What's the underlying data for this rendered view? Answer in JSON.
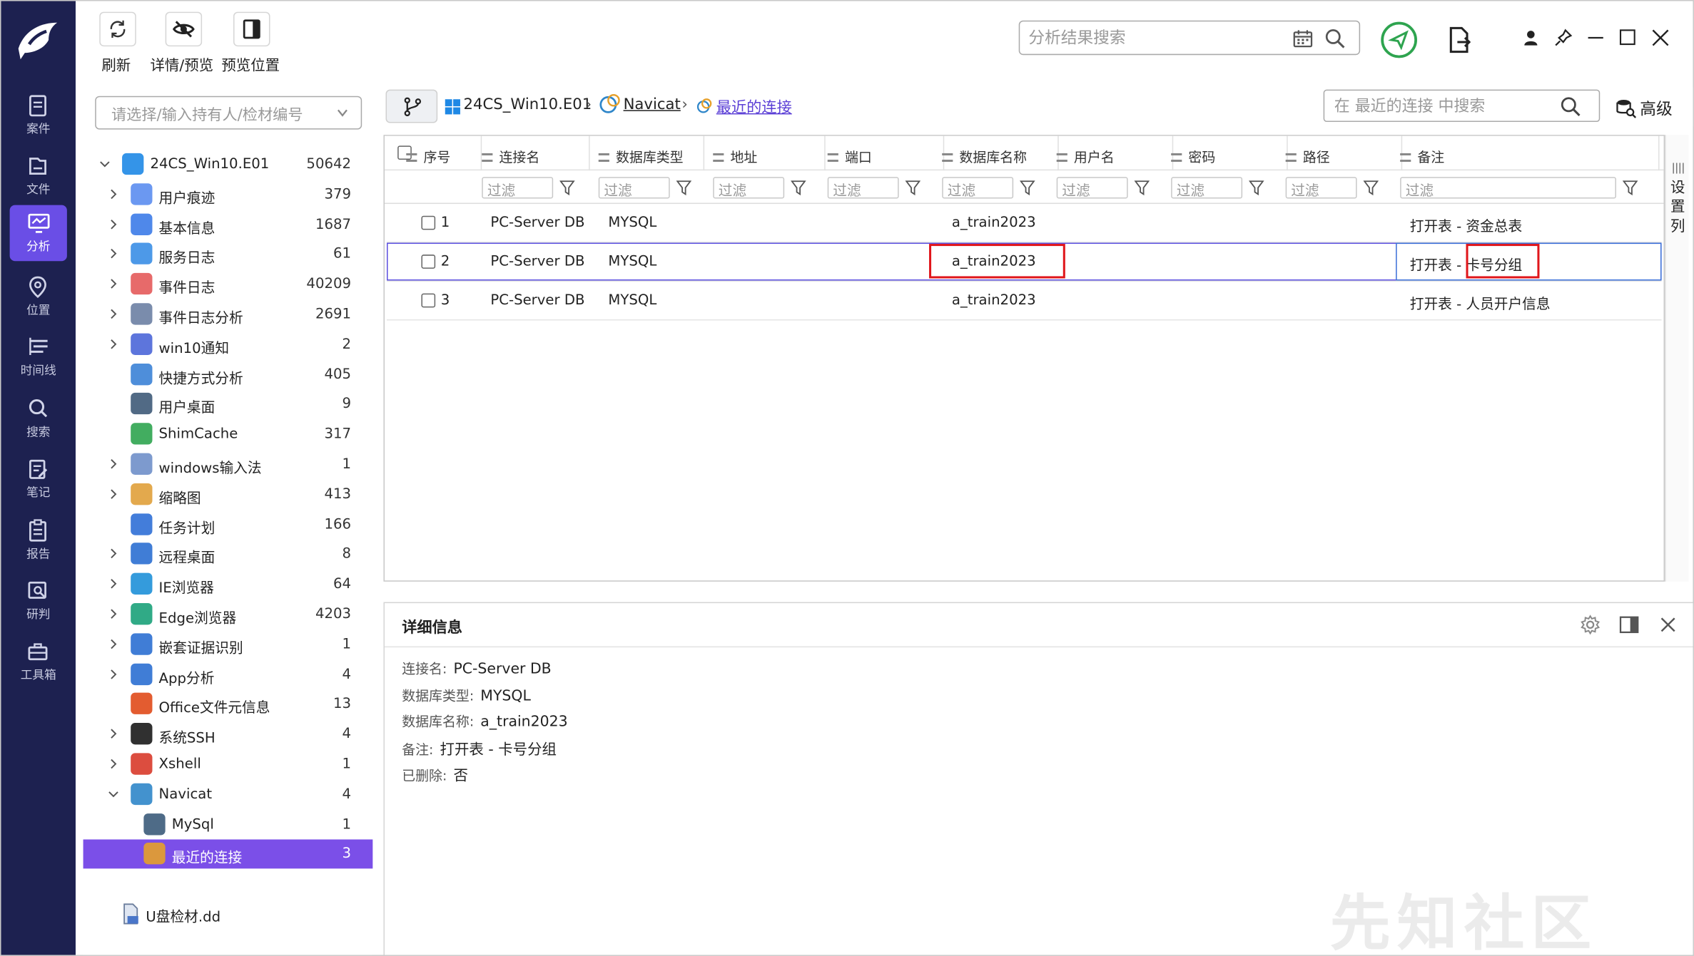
{
  "toolbar": {
    "refresh_label": "刷新",
    "detail_preview_label": "详情/预览",
    "preview_position_label": "预览位置",
    "global_search_placeholder": "分析结果搜索"
  },
  "nav": {
    "items": [
      {
        "label": "案件",
        "icon": "case-icon"
      },
      {
        "label": "文件",
        "icon": "folder-icon"
      },
      {
        "label": "分析",
        "icon": "monitor-analysis-icon"
      },
      {
        "label": "位置",
        "icon": "location-pin-icon"
      },
      {
        "label": "时间线",
        "icon": "timeline-icon"
      },
      {
        "label": "搜索",
        "icon": "search-icon"
      },
      {
        "label": "笔记",
        "icon": "note-icon"
      },
      {
        "label": "报告",
        "icon": "report-icon"
      },
      {
        "label": "研判",
        "icon": "research-icon"
      },
      {
        "label": "工具箱",
        "icon": "toolbox-icon"
      }
    ]
  },
  "evidence": {
    "select_placeholder": "请选择/输入持有人/检材编号",
    "root": {
      "label": "24CS_Win10.E01",
      "count": "50642"
    },
    "items": [
      {
        "label": "用户痕迹",
        "count": "379",
        "icon": "user-traces-icon",
        "color": "#5b8def"
      },
      {
        "label": "基本信息",
        "count": "1687",
        "icon": "basic-info-icon",
        "color": "#3c7be8"
      },
      {
        "label": "服务日志",
        "count": "61",
        "icon": "service-log-icon",
        "color": "#3a8ee6"
      },
      {
        "label": "事件日志",
        "count": "40209",
        "icon": "event-log-icon",
        "color": "#e45a5a"
      },
      {
        "label": "事件日志分析",
        "count": "2691",
        "icon": "event-log-analysis-icon",
        "color": "#6c7fa3"
      },
      {
        "label": "win10通知",
        "count": "2",
        "icon": "bell-icon",
        "color": "#4b66d8"
      },
      {
        "label": "快捷方式分析",
        "count": "405",
        "icon": "shortcut-icon",
        "color": "#3b82d6"
      },
      {
        "label": "用户桌面",
        "count": "9",
        "icon": "desktop-icon",
        "color": "#3e5a78"
      },
      {
        "label": "ShimCache",
        "count": "317",
        "icon": "shimcache-icon",
        "color": "#2ea44f"
      },
      {
        "label": "windows输入法",
        "count": "1",
        "icon": "keyboard-icon",
        "color": "#6f8fc9"
      },
      {
        "label": "缩略图",
        "count": "413",
        "icon": "thumbnail-icon",
        "color": "#e0a03a"
      },
      {
        "label": "任务计划",
        "count": "166",
        "icon": "task-schedule-icon",
        "color": "#2f6fd6"
      },
      {
        "label": "远程桌面",
        "count": "8",
        "icon": "remote-desktop-icon",
        "color": "#2b6fd1"
      },
      {
        "label": "IE浏览器",
        "count": "64",
        "icon": "ie-browser-icon",
        "color": "#1e90d8"
      },
      {
        "label": "Edge浏览器",
        "count": "4203",
        "icon": "edge-browser-icon",
        "color": "#1aa179"
      },
      {
        "label": "嵌套证据识别",
        "count": "1",
        "icon": "nested-evidence-icon",
        "color": "#2b6fd1"
      },
      {
        "label": "App分析",
        "count": "4",
        "icon": "app-grid-icon",
        "color": "#2b6fd1"
      },
      {
        "label": "Office文件元信息",
        "count": "13",
        "icon": "office-icon",
        "color": "#e04a1a"
      },
      {
        "label": "系统SSH",
        "count": "4",
        "icon": "ssh-icon",
        "color": "#1a1a1a"
      },
      {
        "label": "Xshell",
        "count": "1",
        "icon": "xshell-icon",
        "color": "#d83a2a"
      },
      {
        "label": "Navicat",
        "count": "4",
        "icon": "navicat-icon",
        "color": "#2f86c9"
      },
      {
        "label": "MySql",
        "count": "1",
        "icon": "mysql-icon",
        "color": "#3b5b7a"
      },
      {
        "label": "最近的连接",
        "count": "3",
        "icon": "recent-connection-icon",
        "color": "#e6a02a"
      }
    ],
    "extra_file": "U盘检材.dd"
  },
  "breadcrumb": {
    "items": [
      "24CS_Win10.E01",
      "Navicat",
      "最近的连接"
    ],
    "search_placeholder": "在 最近的连接 中搜索",
    "advanced_label": "高级"
  },
  "table": {
    "columns": [
      "序号",
      "连接名",
      "数据库类型",
      "地址",
      "端口",
      "数据库名称",
      "用户名",
      "密码",
      "路径",
      "备注"
    ],
    "filter_placeholder": "过滤",
    "rows": [
      {
        "index": "1",
        "conn": "PC-Server DB",
        "dbtype": "MYSQL",
        "address": "",
        "port": "",
        "dbname": "a_train2023",
        "user": "",
        "password": "",
        "path": "",
        "note": "打开表 - 资金总表"
      },
      {
        "index": "2",
        "conn": "PC-Server DB",
        "dbtype": "MYSQL",
        "address": "",
        "port": "",
        "dbname": "a_train2023",
        "user": "",
        "password": "",
        "path": "",
        "note_prefix": "打开表 - ",
        "note_highlight": "卡号分组"
      },
      {
        "index": "3",
        "conn": "PC-Server DB",
        "dbtype": "MYSQL",
        "address": "",
        "port": "",
        "dbname": "a_train2023",
        "user": "",
        "password": "",
        "path": "",
        "note": "打开表 - 人员开户信息"
      }
    ],
    "side_tab_label": "设置列"
  },
  "detail": {
    "title": "详细信息",
    "fields": [
      {
        "key": "连接名:",
        "value": "PC-Server DB"
      },
      {
        "key": "数据库类型:",
        "value": "MYSQL"
      },
      {
        "key": "数据库名称:",
        "value": "a_train2023"
      },
      {
        "key": "备注:",
        "value": "打开表 - 卡号分组"
      },
      {
        "key": "已删除:",
        "value": "否"
      }
    ]
  },
  "watermark": "先知社区",
  "colors": {
    "rail": "#1d2150",
    "accent": "#6a4ee6",
    "selected": "#7b4fe8",
    "highlight": "#e0161b"
  }
}
